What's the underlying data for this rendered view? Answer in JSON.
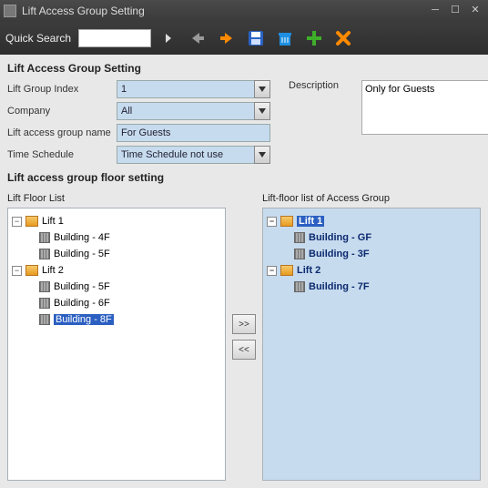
{
  "titlebar": {
    "title": "Lift Access Group Setting"
  },
  "toolbar": {
    "quick_search_label": "Quick Search",
    "quick_search_value": ""
  },
  "form": {
    "section_title": "Lift Access Group Setting",
    "index_label": "Lift Group Index",
    "index_value": "1",
    "company_label": "Company",
    "company_value": "All",
    "name_label": "Lift access group name",
    "name_value": "For Guests",
    "schedule_label": "Time Schedule",
    "schedule_value": "Time Schedule not use",
    "desc_label": "Description",
    "desc_value": "Only for Guests"
  },
  "floors": {
    "section_title": "Lift access group floor setting",
    "left_title": "Lift  Floor List",
    "right_title": "Lift-floor list of Access Group",
    "move_right": ">>",
    "move_left": "<<",
    "left_tree": {
      "lift1": {
        "label": "Lift 1",
        "f1": "Building - 4F",
        "f2": "Building - 5F"
      },
      "lift2": {
        "label": "Lift 2",
        "f1": "Building - 5F",
        "f2": "Building - 6F",
        "f3": "Building - 8F"
      }
    },
    "right_tree": {
      "lift1": {
        "label": "Lift 1",
        "f1": "Building - GF",
        "f2": "Building - 3F"
      },
      "lift2": {
        "label": "Lift 2",
        "f1": "Building - 7F"
      }
    }
  }
}
